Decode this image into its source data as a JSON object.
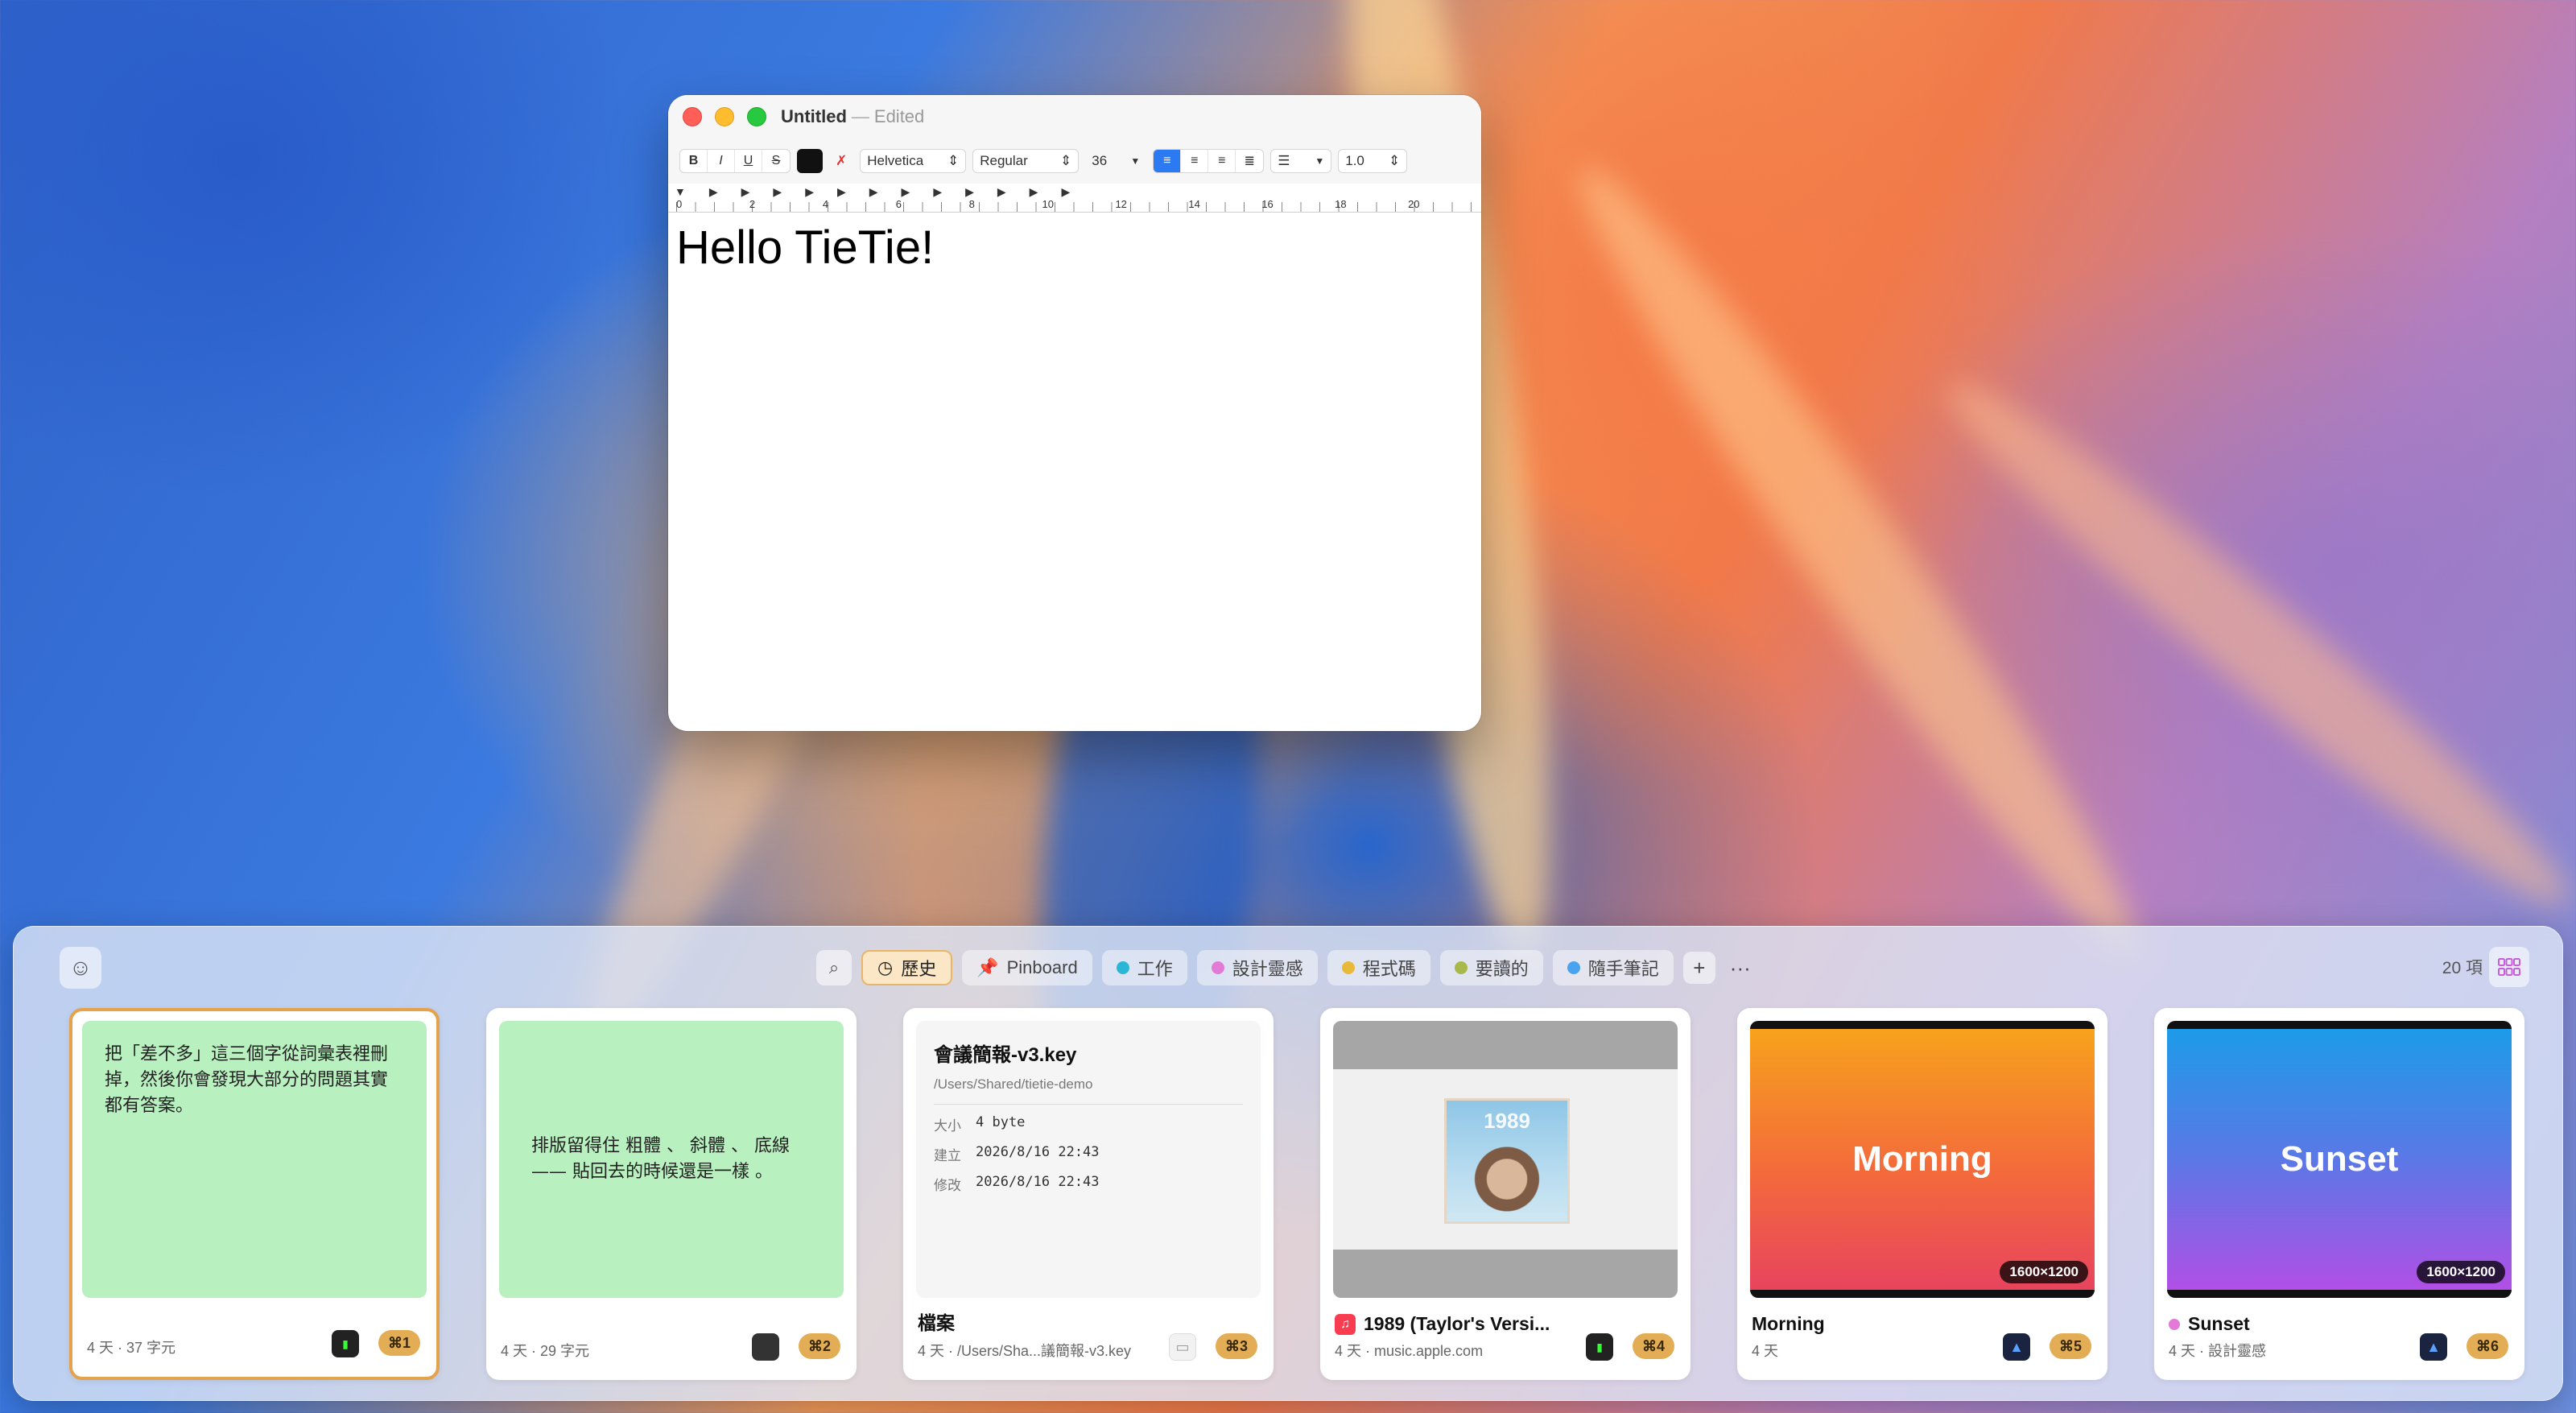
{
  "window": {
    "title": "Untitled",
    "separator": "—",
    "status": "Edited",
    "toolbar": {
      "bold": "B",
      "italic": "I",
      "underline": "U",
      "strike": "S",
      "font_family": "Helvetica",
      "font_style": "Regular",
      "font_size": "36",
      "line_spacing": "1.0"
    },
    "ruler_numbers": [
      "0",
      "2",
      "4",
      "6",
      "8",
      "10",
      "12",
      "14",
      "16",
      "18",
      "20"
    ],
    "document_text": "Hello TieTie!"
  },
  "panel": {
    "tabs": [
      {
        "label": "歷史",
        "color": "",
        "active": true
      },
      {
        "label": "Pinboard",
        "color": ""
      },
      {
        "label": "工作",
        "color": "#2bb6d6"
      },
      {
        "label": "設計靈感",
        "color": "#e27ad6"
      },
      {
        "label": "程式碼",
        "color": "#e8b93a"
      },
      {
        "label": "要讀的",
        "color": "#a9b84a"
      },
      {
        "label": "隨手筆記",
        "color": "#4aa3ee"
      }
    ],
    "count": "20 項",
    "cards": [
      {
        "preview_text": "把「差不多」這三個字從詞彙表裡刪掉，然後你會發現大部分的問題其實都有答案。",
        "title": "",
        "sub": "4 天 · 37 字元",
        "shortcut": "⌘1"
      },
      {
        "preview_text": "排版留得住 粗體 、 斜體 、 底線 —— 貼回去的時候還是一樣 。",
        "title": "",
        "sub": "4 天 · 29 字元",
        "shortcut": "⌘2"
      },
      {
        "file_name": "會議簡報-v3.key",
        "file_path": "/Users/Shared/tietie-demo",
        "size_label": "大小",
        "size_value": "4 byte",
        "created_label": "建立",
        "created_value": "2026/8/16 22:43",
        "modified_label": "修改",
        "modified_value": "2026/8/16 22:43",
        "title": "檔案",
        "sub": "4 天 · /Users/Sha...議簡報-v3.key",
        "shortcut": "⌘3"
      },
      {
        "art_text": "1989",
        "title": "1989 (Taylor's Versi...",
        "sub": "4 天 · music.apple.com",
        "shortcut": "⌘4"
      },
      {
        "image_text": "Morning",
        "dims": "1600×1200",
        "title": "Morning",
        "sub": "4 天",
        "shortcut": "⌘5"
      },
      {
        "image_text": "Sunset",
        "dims": "1600×1200",
        "title": "Sunset",
        "sub": "4 天 · 設計靈感",
        "shortcut": "⌘6",
        "tag_color": "#e27ad6"
      }
    ]
  }
}
